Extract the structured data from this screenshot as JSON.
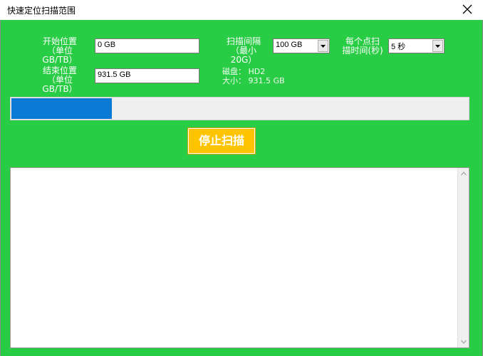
{
  "window": {
    "title": "快速定位扫描范围"
  },
  "form": {
    "start": {
      "label_line1": "开始位置",
      "label_line2": "（单位GB/TB）",
      "value": "0 GB"
    },
    "end": {
      "label_line1": "结束位置",
      "label_line2": "（单位GB/TB）",
      "value": "931.5 GB"
    },
    "interval": {
      "label_line1": "扫描间隔",
      "label_line2": "（最小20G）",
      "value": "100 GB"
    },
    "time_per_point": {
      "label_line1": "每个点扫",
      "label_line2": "描时间(秒)",
      "value": "5 秒"
    }
  },
  "disk_info": {
    "disk_label": "磁盘：",
    "disk_value": "HD2",
    "size_label": "大小：",
    "size_value": "931.5 GB"
  },
  "progress": {
    "fraction": 0.22,
    "fill_color": "#0a7ad4"
  },
  "actions": {
    "stop_label": "停止扫描"
  },
  "log": {
    "text": ""
  },
  "colors": {
    "background": "#29cc45",
    "button": "#ffc400",
    "progress_track": "#efefef"
  },
  "icons": {
    "close": "close-icon",
    "dropdown": "chevron-down-icon",
    "scroll_up": "scroll-up-icon",
    "scroll_down": "scroll-down-icon"
  }
}
